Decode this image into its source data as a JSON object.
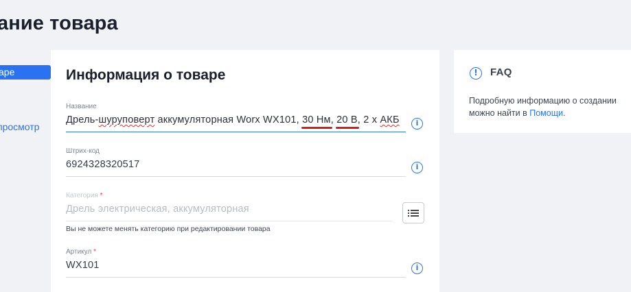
{
  "page": {
    "title": "ание товара"
  },
  "sidebar": {
    "active_item": "аре",
    "preview_link": "просмотр"
  },
  "form": {
    "title": "Информация о товаре",
    "name": {
      "label": "Название",
      "value_parts": {
        "p1": "Дрель-",
        "p2": "шуруповерт",
        "p3": " аккумуляторная Worx WX101, ",
        "p4": "30 Нм",
        "p5": ", ",
        "p6": "20 В",
        "p7": ", 2 x ",
        "p8": "АКБ"
      }
    },
    "barcode": {
      "label": "Штрих-код",
      "value": "6924328320517"
    },
    "category": {
      "label": "Категория",
      "required_mark": "*",
      "value": "Дрель электрическая, аккумуляторная",
      "hint": "Вы не можете менять категорию при редактировании товара"
    },
    "sku": {
      "label": "Артикул",
      "required_mark": "*",
      "value": "WX101"
    }
  },
  "faq": {
    "title": "FAQ",
    "text_line1": "Подробную информацию о создании",
    "text_line2_prefix": "можно найти в ",
    "link": "Помощи",
    "text_line2_suffix": "."
  },
  "icons": {
    "info": "info-circle-icon",
    "list": "list-icon",
    "faq": "exclamation-circle-icon"
  },
  "colors": {
    "accent": "#2b72f0",
    "required": "#e2394a",
    "annotation": "#d81b1b"
  }
}
